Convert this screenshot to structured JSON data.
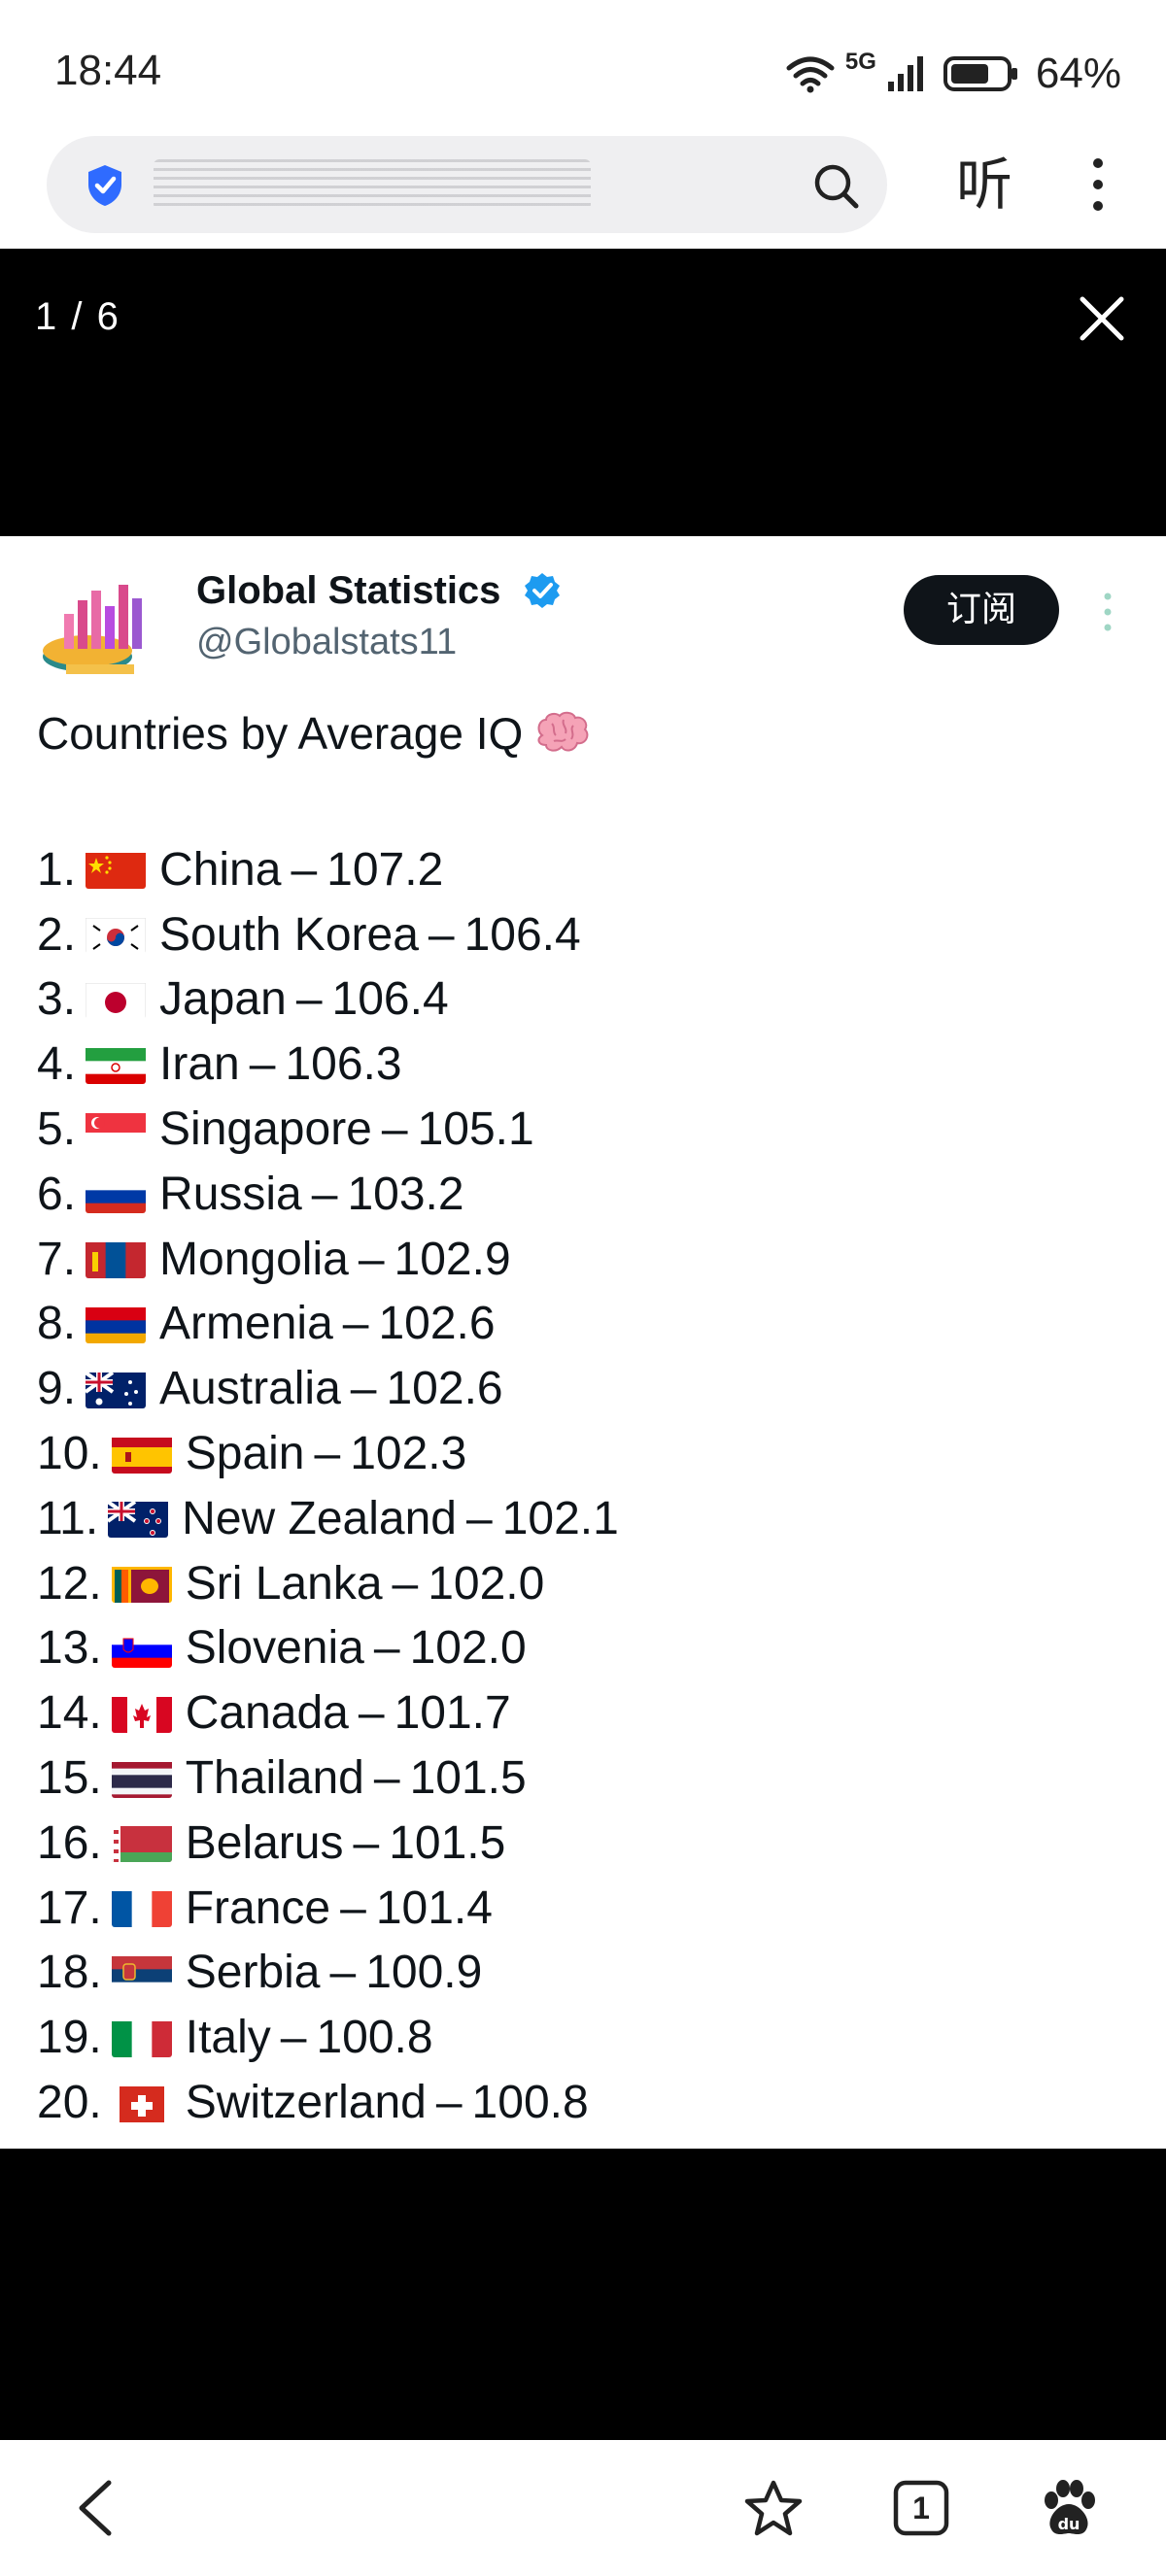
{
  "status_bar": {
    "time": "18:44",
    "network": "5G",
    "battery": "64%"
  },
  "browser": {
    "listen_label": "听",
    "icons": [
      "shield-icon",
      "search-icon",
      "more-icon"
    ]
  },
  "viewer": {
    "counter": "1 / 6"
  },
  "tweet": {
    "author_name": "Global Statistics",
    "author_handle": "@Globalstats11",
    "subscribe_label": "订阅",
    "title": "Countries by Average IQ",
    "title_emoji": "brain",
    "items": [
      {
        "rank": "1.",
        "country": "China",
        "value": "107.2",
        "flag": "cn"
      },
      {
        "rank": "2.",
        "country": "South Korea",
        "value": "106.4",
        "flag": "kr"
      },
      {
        "rank": "3.",
        "country": "Japan",
        "value": "106.4",
        "flag": "jp"
      },
      {
        "rank": "4.",
        "country": "Iran",
        "value": "106.3",
        "flag": "ir"
      },
      {
        "rank": "5.",
        "country": "Singapore",
        "value": "105.1",
        "flag": "sg"
      },
      {
        "rank": "6.",
        "country": "Russia",
        "value": "103.2",
        "flag": "ru"
      },
      {
        "rank": "7.",
        "country": "Mongolia",
        "value": "102.9",
        "flag": "mn"
      },
      {
        "rank": "8.",
        "country": "Armenia",
        "value": "102.6",
        "flag": "am"
      },
      {
        "rank": "9.",
        "country": "Australia",
        "value": "102.6",
        "flag": "au"
      },
      {
        "rank": "10.",
        "country": "Spain",
        "value": "102.3",
        "flag": "es"
      },
      {
        "rank": "11.",
        "country": "New Zealand",
        "value": "102.1",
        "flag": "nz"
      },
      {
        "rank": "12.",
        "country": "Sri Lanka",
        "value": "102.0",
        "flag": "lk"
      },
      {
        "rank": "13.",
        "country": "Slovenia",
        "value": "102.0",
        "flag": "si"
      },
      {
        "rank": "14.",
        "country": "Canada",
        "value": "101.7",
        "flag": "ca"
      },
      {
        "rank": "15.",
        "country": "Thailand",
        "value": "101.5",
        "flag": "th"
      },
      {
        "rank": "16.",
        "country": "Belarus",
        "value": "101.5",
        "flag": "by"
      },
      {
        "rank": "17.",
        "country": "France",
        "value": "101.4",
        "flag": "fr"
      },
      {
        "rank": "18.",
        "country": "Serbia",
        "value": "100.9",
        "flag": "rs"
      },
      {
        "rank": "19.",
        "country": "Italy",
        "value": "100.8",
        "flag": "it"
      },
      {
        "rank": "20.",
        "country": "Switzerland",
        "value": "100.8",
        "flag": "ch"
      }
    ]
  },
  "bottom_nav": {
    "tab_count": "1",
    "icons": [
      "back-icon",
      "star-icon",
      "tabs-icon",
      "baidu-paw-icon"
    ]
  },
  "colors": {
    "verified": "#1d9bf0",
    "shield": "#2f6bff",
    "viewer_bg": "#000000",
    "button_dark": "#0f1419"
  }
}
